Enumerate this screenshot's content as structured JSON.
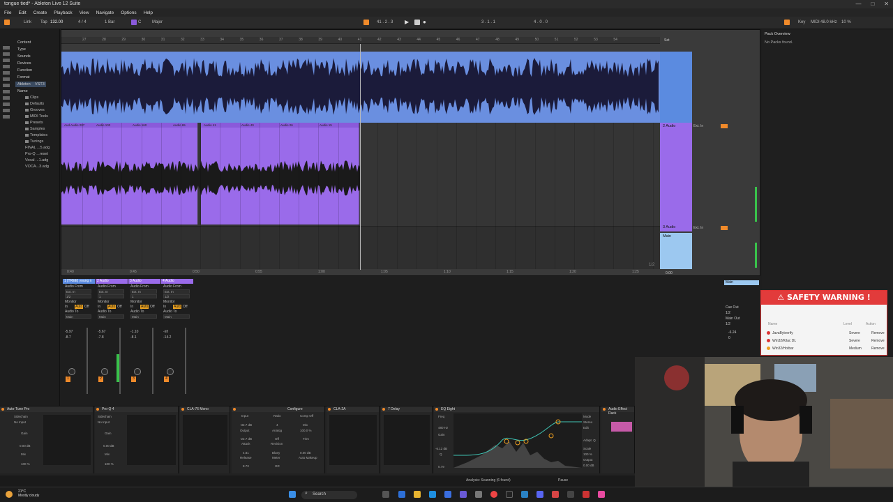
{
  "window": {
    "title": "tongue tied* - Ableton Live 12 Suite",
    "controls": [
      "—",
      "□",
      "✕"
    ]
  },
  "menu": [
    "File",
    "Edit",
    "Create",
    "Playback",
    "View",
    "Navigate",
    "Options",
    "Help"
  ],
  "controlbar": {
    "link": "Link",
    "tap": "Tap",
    "tempo": "132.00",
    "time_sig": "4 / 4",
    "quantize": "1 Bar",
    "key": "C",
    "scale": "Major",
    "position": "41 . 2 . 3",
    "loop_start": "3 . 1 . 1",
    "loop_len": "4 . 0 . 0",
    "key_btn": "Key",
    "midi_btn": "MIDI",
    "sample_rate": "48.0 kHz",
    "cpu": "10 %"
  },
  "browser": {
    "categories": [
      "Content",
      "Type",
      "Sounds",
      "Devices",
      "Function",
      "Format",
      "Ableton",
      "VST3"
    ],
    "section": "Name",
    "folders": [
      "Clips",
      "Defaults",
      "Grooves",
      "MIDI Tools",
      "Presets",
      "Samples",
      "Templates",
      "Tunings"
    ],
    "files": [
      "FINAL ...5.adg",
      "Pro-Q ...reset",
      "Vocal ...1.adg",
      "VOCA...3.adg"
    ]
  },
  "arrangement": {
    "ruler": [
      "27",
      "28",
      "29",
      "30",
      "31",
      "32",
      "33",
      "34",
      "35",
      "36",
      "37",
      "38",
      "39",
      "40",
      "41",
      "42",
      "43",
      "44",
      "45",
      "46",
      "47",
      "48",
      "49",
      "50",
      "51",
      "52",
      "53",
      "54"
    ],
    "time": [
      "0:40",
      "0:45",
      "0:50",
      "0:55",
      "1:00",
      "1:05",
      "1:10",
      "1:15",
      "1:20",
      "1:25"
    ],
    "clips": [
      "Aud Audio 207",
      "Audio 103",
      "Audio 160",
      "Audio 65",
      "Audio 46",
      "Audio 41",
      "Audio 40",
      "Audio 26",
      "Audio 15",
      "Audio 12"
    ],
    "tracks": [
      {
        "name": "",
        "input": "",
        "color": "#5b8be0"
      },
      {
        "name": "2 Audio",
        "input": "Ext. In",
        "color": "#9a6bea"
      },
      {
        "name": "3 Audio",
        "input": "Ext. In",
        "color": "#9a6bea"
      },
      {
        "name": "Main",
        "input": "",
        "color": "#9cc8f0"
      }
    ],
    "set_label": "Set",
    "page": "1/2",
    "zoom": "0.00"
  },
  "mixer": {
    "strips": [
      {
        "name": "1 [TREE] young n",
        "from": "Audio From",
        "src": "Ext. In",
        "ch": "1/2",
        "monitor": "Monitor",
        "in": "In",
        "auto": "Auto",
        "off": "Off",
        "to": "Audio To",
        "dest": "Main",
        "vol": "-5.97",
        "vol2": "-8.7",
        "num": "1"
      },
      {
        "name": "2 Audio",
        "from": "Audio From",
        "src": "Ext. In",
        "ch": "1",
        "monitor": "Monitor",
        "in": "In",
        "auto": "Auto",
        "off": "Off",
        "to": "Audio To",
        "dest": "Main",
        "vol": "-5.67",
        "vol2": "-7.8",
        "num": "2"
      },
      {
        "name": "3 Audio",
        "from": "Audio From",
        "src": "Ext. In",
        "ch": "1",
        "monitor": "Monitor",
        "in": "In",
        "auto": "Auto",
        "off": "Off",
        "to": "Audio To",
        "dest": "Main",
        "vol": "-1.10",
        "vol2": "-8.1",
        "num": "3"
      },
      {
        "name": "4 Audio",
        "from": "Audio From",
        "src": "Ext. In",
        "ch": "1/2",
        "monitor": "Monitor",
        "in": "In",
        "auto": "Auto",
        "off": "Off",
        "to": "Audio To",
        "dest": "Main",
        "vol": "-inf",
        "vol2": "-14.2",
        "num": "4"
      }
    ],
    "main": {
      "name": "Main",
      "cue_out": "Cue Out",
      "cue_val": "1/2",
      "main_out": "Main Out",
      "main_val": "1/2",
      "vol": "-6.24",
      "vol2": "0"
    }
  },
  "devices": {
    "chain": [
      {
        "name": "Auto-Tune Pro",
        "sidechain": "Sidechain",
        "input": "No Input",
        "gain": "Gain",
        "gain_val": "0.00 dB",
        "mix": "Mix",
        "mix_val": "100 %"
      },
      {
        "name": "Pro-Q 4",
        "sidechain": "Sidechain",
        "input": "No Input",
        "gain": "Gain",
        "gain_val": "0.00 dB",
        "mix": "Mix",
        "mix_val": "100 %"
      },
      {
        "name": "CLA-76 Mono"
      },
      {
        "name": "Glue Compressor"
      },
      {
        "name": "CLA-2A"
      },
      {
        "name": "7 Delay"
      },
      {
        "name": "EQ Eight"
      },
      {
        "name": "Audio Effect Rack"
      }
    ],
    "comp": {
      "input": "Input",
      "input_val": "-32.7 dB",
      "output": "Output",
      "output_val": "-22.7 dB",
      "attack": "Attack",
      "attack_val": "4.81",
      "release": "Release",
      "release_val": "8.73",
      "ratio": "Ratio",
      "ratio_val": "4",
      "analog": "Analog",
      "analog_val": "Off",
      "revision": "Revision",
      "bluey": "Bluey",
      "meter": "Meter",
      "meter_val": "GR",
      "compoff": "Comp Off",
      "mix": "Mix",
      "mix_val": "100.0 %",
      "trim": "Trim",
      "trim_val": "0.00 dB",
      "makeup": "Auto Makeup",
      "configure": "Configure"
    },
    "eq": {
      "freq": "Freq",
      "freq_val": "480 Hz",
      "gain": "Gain",
      "gain_val": "-6.12 dB",
      "q": "Q",
      "q_val": "0.79",
      "mode": "Mode",
      "mode_val": "Stereo",
      "edit": "Edit",
      "adapt": "Adapt. Q",
      "scale": "Scale",
      "scale_val": "100 %",
      "output": "Output",
      "output_val": "0.00 dB"
    }
  },
  "right_panel": {
    "title": "Pack Overview",
    "empty": "No Packs found."
  },
  "warning": {
    "title": "⚠ SAFETY WARNING !",
    "columns": [
      "Name",
      "Level",
      "Action"
    ],
    "rows": [
      {
        "name": "JavaBytverify",
        "level": "Severe",
        "action": "Remove",
        "color": "#d33"
      },
      {
        "name": "Win32/Kilac DL",
        "level": "Severe",
        "action": "Remove",
        "color": "#d33"
      },
      {
        "name": "Win32/Hotbar",
        "level": "Medium",
        "action": "Remove",
        "color": "#f0a020"
      }
    ]
  },
  "status": {
    "analysis": "Analysis: Scanning (6 found)",
    "pause": "Pause"
  },
  "taskbar": {
    "temp": "21°C",
    "weather": "Mostly cloudy",
    "search": "Search"
  }
}
